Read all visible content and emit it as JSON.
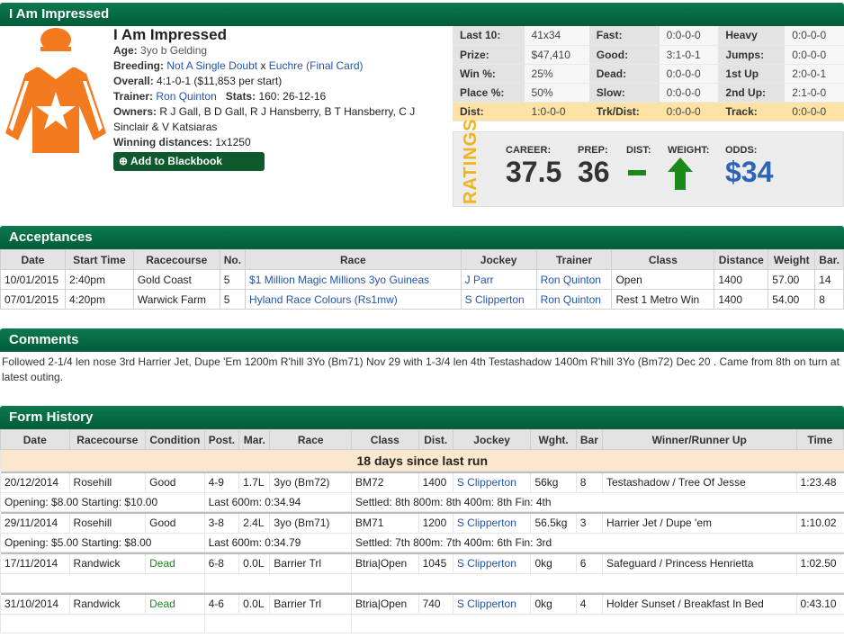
{
  "horse": {
    "header": "I Am Impressed",
    "name": "I Am Impressed",
    "age_label": "Age:",
    "age": "3yo b Gelding",
    "breeding_label": "Breeding:",
    "sire": "Not A Single Doubt",
    "x": "x",
    "dam": "Euchre",
    "dam_sire": "(Final Card)",
    "overall_label": "Overall:",
    "overall": "4:1-0-1 ($11,853 per start)",
    "trainer_label": "Trainer:",
    "trainer": "Ron Quinton",
    "stats_label": "Stats:",
    "stats": "160: 26-12-16",
    "owners_label": "Owners:",
    "owners": "R J Gall, B D Gall, R J Hansberry, B T Hansberry, C J Sinclair & V Katsiaras",
    "windist_label": "Winning distances:",
    "windist": "1x1250",
    "blackbook_button": "Add to Blackbook",
    "silks_colors": {
      "body": "#f47a1f",
      "star": "#ffffff"
    }
  },
  "stats": [
    [
      [
        "Last 10:",
        "41x34"
      ],
      [
        "Fast:",
        "0:0-0-0"
      ],
      [
        "Heavy",
        "0:0-0-0"
      ]
    ],
    [
      [
        "Prize:",
        "$47,410"
      ],
      [
        "Good:",
        "3:1-0-1"
      ],
      [
        "Jumps:",
        "0:0-0-0"
      ]
    ],
    [
      [
        "Win %:",
        "25%"
      ],
      [
        "Dead:",
        "0:0-0-0"
      ],
      [
        "1st Up",
        "2:0-0-1"
      ]
    ],
    [
      [
        "Place %:",
        "50%"
      ],
      [
        "Slow:",
        "0:0-0-0"
      ],
      [
        "2nd Up:",
        "2:1-0-0"
      ]
    ],
    [
      [
        "Dist:",
        "1:0-0-0"
      ],
      [
        "Trk/Dist:",
        "0:0-0-0"
      ],
      [
        "Track:",
        "0:0-0-0"
      ]
    ]
  ],
  "ratings": {
    "word": "RATINGS",
    "career_label": "CAREER:",
    "career": "37.5",
    "prep_label": "PREP:",
    "prep": "36",
    "dist_label": "DIST:",
    "dist_icon": "dash-icon",
    "weight_label": "WEIGHT:",
    "weight_icon": "up-arrow-icon",
    "odds_label": "ODDS:",
    "odds": "$34"
  },
  "acceptances": {
    "title": "Acceptances",
    "columns": [
      "Date",
      "Start Time",
      "Racecourse",
      "No.",
      "Race",
      "Jockey",
      "Trainer",
      "Class",
      "Distance",
      "Weight",
      "Bar."
    ],
    "rows": [
      [
        "10/01/2015",
        "2:40pm",
        "Gold Coast",
        "5",
        "$1 Million Magic Millions 3yo Guineas",
        "J Parr",
        "Ron Quinton",
        "Open",
        "1400",
        "57.00",
        "14"
      ],
      [
        "07/01/2015",
        "4:20pm",
        "Warwick Farm",
        "5",
        "Hyland Race Colours (Rs1mw)",
        "S Clipperton",
        "Ron Quinton",
        "Rest 1 Metro Win",
        "1400",
        "54.00",
        "8"
      ]
    ]
  },
  "comments": {
    "title": "Comments",
    "text": "Followed 2-1/4 len nose 3rd Harrier Jet, Dupe 'Em 1200m R'hill 3Yo (Bm71) Nov 29 with 1-3/4 len 4th Testashadow 1400m R'hill 3Yo (Bm72) Dec 20 . Came from 8th on turn at latest outing."
  },
  "form": {
    "title": "Form History",
    "columns": [
      "Date",
      "Racecourse",
      "Condition",
      "Post.",
      "Mar.",
      "Race",
      "Class",
      "Dist.",
      "Jockey",
      "Wght.",
      "Bar",
      "Winner/Runner Up",
      "Time"
    ],
    "since_last": "18 days since last run",
    "runs": [
      {
        "cells": [
          "20/12/2014",
          "Rosehill",
          "Good",
          "4-9",
          "1.7L",
          "3yo (Bm72)",
          "BM72",
          "1400",
          "S Clipperton",
          "56kg",
          "8",
          "Testashadow / Tree Of Jesse",
          "1:23.48"
        ],
        "odds": "Opening: $8.00   Starting: $10.00",
        "last600": "Last 600m: 0:34.94",
        "settled": "Settled: 8th 800m: 8th 400m: 8th Fin: 4th"
      },
      {
        "cells": [
          "29/11/2014",
          "Rosehill",
          "Good",
          "3-8",
          "2.4L",
          "3yo (Bm71)",
          "BM71",
          "1200",
          "S Clipperton",
          "56.5kg",
          "3",
          "Harrier Jet / Dupe 'em",
          "1:10.02"
        ],
        "odds": "Opening: $5.00   Starting: $8.00",
        "last600": "Last 600m: 0:34.79",
        "settled": "Settled: 7th 800m: 7th 400m: 6th Fin: 3rd"
      },
      {
        "cells": [
          "17/11/2014",
          "Randwick",
          "Dead",
          "6-8",
          "0.0L",
          "Barrier Trl",
          "Btria|Open",
          "1045",
          "S Clipperton",
          "0kg",
          "6",
          "Safeguard / Princess Henrietta",
          "1:02.50"
        ],
        "odds": "",
        "last600": "",
        "settled": ""
      },
      {
        "cells": [
          "31/10/2014",
          "Randwick",
          "Dead",
          "4-6",
          "0.0L",
          "Barrier Trl",
          "Btria|Open",
          "740",
          "S Clipperton",
          "0kg",
          "4",
          "Holder Sunset / Breakfast In Bed",
          "0:43.10"
        ],
        "odds": "",
        "last600": "",
        "settled": ""
      }
    ]
  }
}
